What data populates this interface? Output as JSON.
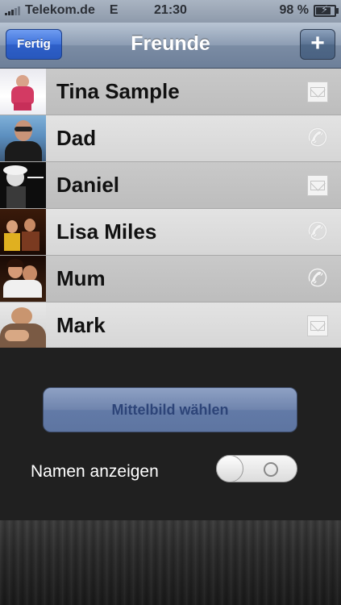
{
  "status_bar": {
    "carrier": "Telekom.de",
    "network": "E",
    "time": "21:30",
    "battery": "98 %",
    "battery_level": 0.98
  },
  "nav": {
    "title": "Freunde",
    "left_button": "Fertig",
    "right_button": "+"
  },
  "friends": [
    {
      "name": "Tina Sample",
      "contact_icon": "mail-icon"
    },
    {
      "name": "Dad",
      "contact_icon": "phone-icon"
    },
    {
      "name": "Daniel",
      "contact_icon": "mail-icon"
    },
    {
      "name": "Lisa Miles",
      "contact_icon": "phone-icon"
    },
    {
      "name": "Mum",
      "contact_icon": "phone-icon"
    },
    {
      "name": "Mark",
      "contact_icon": "mail-icon"
    }
  ],
  "settings": {
    "choose_center_image_button": "Mittelbild wählen",
    "show_names_label": "Namen anzeigen",
    "show_names_enabled": false
  },
  "colors": {
    "nav_bar": "#7b8ca4",
    "done_button": "#3f72da",
    "panel_background": "#202020"
  }
}
